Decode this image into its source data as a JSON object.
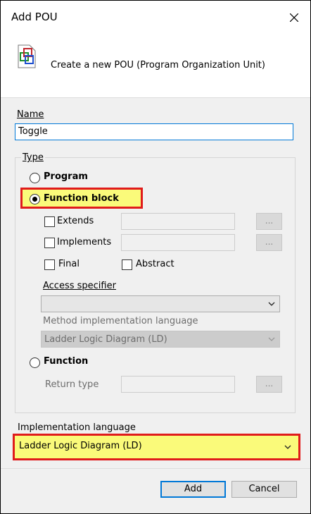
{
  "window": {
    "title": "Add POU",
    "close_glyph": "✕"
  },
  "header": {
    "description": "Create a new POU (Program Organization Unit)",
    "icon": "pou-icon"
  },
  "name": {
    "label": "Name",
    "value": "Toggle"
  },
  "type": {
    "label": "Type",
    "program": "Program",
    "function_block": "Function block",
    "extends": "Extends",
    "implements": "Implements",
    "ellipsis": "...",
    "final": "Final",
    "abstract": "Abstract",
    "access_specifier": "Access specifier",
    "access_value": "",
    "method_impl_label": "Method implementation language",
    "method_impl_value": "Ladder Logic Diagram (LD)",
    "function": "Function",
    "return_type": "Return type",
    "selected": "Function block"
  },
  "implementation": {
    "label": "Implementation language",
    "value": "Ladder Logic Diagram (LD)"
  },
  "buttons": {
    "add": "Add",
    "cancel": "Cancel"
  },
  "colors": {
    "highlight": "#fafa7a",
    "annotation_border": "#e01b1b",
    "focus": "#0078d7"
  }
}
